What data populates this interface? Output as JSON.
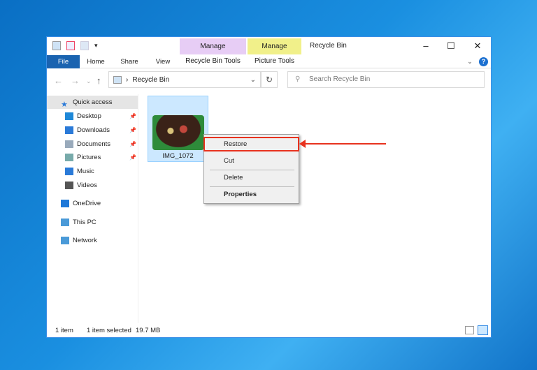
{
  "window": {
    "title": "Recycle Bin"
  },
  "ribbon": {
    "file": "File",
    "tabs": [
      "Home",
      "Share",
      "View"
    ],
    "contextual": [
      {
        "header": "Manage",
        "tab": "Recycle Bin Tools",
        "color": "#e7cdf5"
      },
      {
        "header": "Manage",
        "tab": "Picture Tools",
        "color": "#f1f08a"
      }
    ]
  },
  "address": {
    "path": "Recycle Bin",
    "search_placeholder": "Search Recycle Bin"
  },
  "sidebar": {
    "items": [
      {
        "label": "Quick access",
        "icon": "star-icon",
        "color": "#2a7ad8"
      },
      {
        "label": "Desktop",
        "icon": "desktop-icon",
        "pinned": true,
        "color": "#1e88d8"
      },
      {
        "label": "Downloads",
        "icon": "download-icon",
        "pinned": true,
        "color": "#2a7ad8"
      },
      {
        "label": "Documents",
        "icon": "documents-icon",
        "pinned": true,
        "color": "#9ab"
      },
      {
        "label": "Pictures",
        "icon": "pictures-icon",
        "pinned": true,
        "color": "#7aa"
      },
      {
        "label": "Music",
        "icon": "music-icon",
        "color": "#2a7ad8"
      },
      {
        "label": "Videos",
        "icon": "videos-icon",
        "color": "#555"
      },
      {
        "label": "OneDrive",
        "icon": "cloud-icon",
        "color": "#1e78d8"
      },
      {
        "label": "This PC",
        "icon": "computer-icon",
        "color": "#4a9ad8"
      },
      {
        "label": "Network",
        "icon": "network-icon",
        "color": "#4a9ad8"
      }
    ]
  },
  "files": [
    {
      "name": "IMG_1072",
      "selected": true
    }
  ],
  "context_menu": {
    "items": [
      "Restore",
      "Cut",
      "Delete",
      "Properties"
    ],
    "highlighted": "Restore"
  },
  "status": {
    "count": "1 item",
    "selected": "1 item selected",
    "size": "19.7 MB"
  }
}
